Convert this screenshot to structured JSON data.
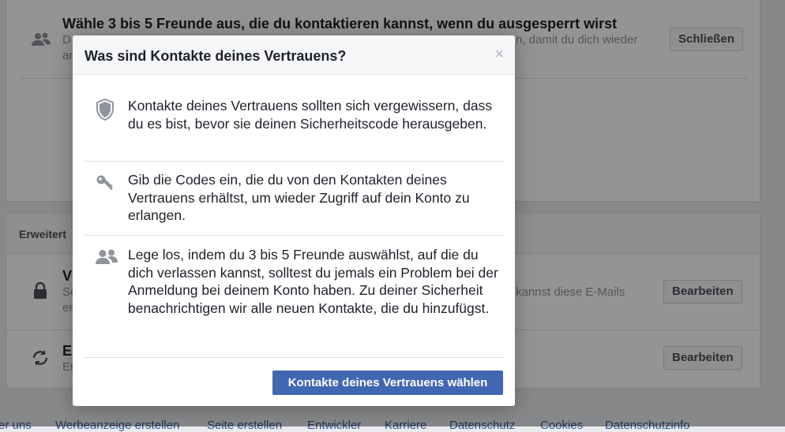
{
  "background": {
    "trusted_contacts_row": {
      "title": "Wähle 3 bis 5 Freunde aus, die du kontaktieren kannst, wenn du ausgesperrt wirst",
      "subtitle_left": "D",
      "subtitle_right": "n, damit du dich wieder",
      "subtitle_line2": "ar",
      "button": "Schließen"
    },
    "advanced_header": "Erweitert",
    "email_row": {
      "title": "V",
      "subtitle_left": "Sc",
      "subtitle_right": "kannst diese E-Mails",
      "subtitle_line2": "er",
      "button": "Bearbeiten"
    },
    "recovery_row": {
      "title": "E",
      "subtitle_left": "Er",
      "button": "Bearbeiten"
    },
    "footer_links": [
      "er uns",
      "Werbeanzeige erstellen",
      "Seite erstellen",
      "Entwickler",
      "Karriere",
      "Datenschutz",
      "Cookies",
      "Datenschutzinfo"
    ]
  },
  "dialog": {
    "title": "Was sind Kontakte deines Vertrauens?",
    "close_glyph": "×",
    "items": [
      {
        "icon": "shield-icon",
        "text": "Kontakte deines Vertrauens sollten sich vergewissern, dass du es bist, bevor sie deinen Sicherheitscode herausgeben."
      },
      {
        "icon": "key-icon",
        "text": "Gib die Codes ein, die du von den Kontakten deines Vertrauens erhältst, um wieder Zugriff auf dein Konto zu erlangen."
      },
      {
        "icon": "people-icon",
        "text": "Lege los, indem du 3 bis 5 Freunde auswählst, auf die du dich verlassen kannst, solltest du jemals ein Problem bei der Anmeldung bei deinem Konto haben. Zu deiner Sicherheit benachrichtigen wir alle neuen Kontakte, die du hinzufügst."
      }
    ],
    "primary_button": "Kontakte deines Vertrauens wählen"
  },
  "colors": {
    "primary": "#4267b2",
    "link": "#365899",
    "icon_gray": "#90949c"
  }
}
